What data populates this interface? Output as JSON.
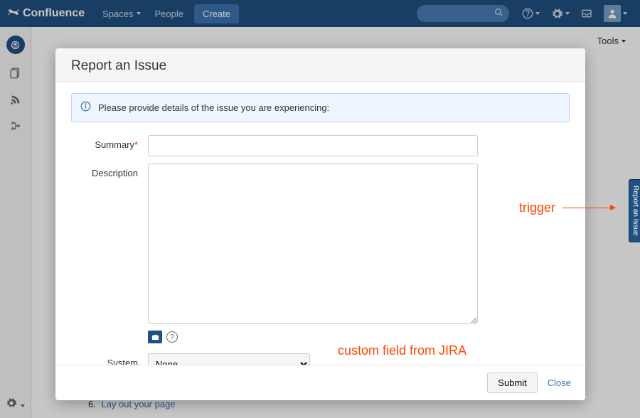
{
  "topnav": {
    "logo_text": "Confluence",
    "spaces": "Spaces",
    "people": "People",
    "create": "Create"
  },
  "page": {
    "tools": "Tools",
    "bottom_list_num": "6.",
    "bottom_link": "Lay out your page"
  },
  "side_tab": "Report an Issue",
  "modal": {
    "title": "Report an Issue",
    "banner": "Please provide details of the issue you are experiencing:",
    "summary_label": "Summary",
    "description_label": "Description",
    "system_label": "System",
    "system_value": "None",
    "submit": "Submit",
    "close": "Close"
  },
  "annotations": {
    "trigger": "trigger",
    "custom_field": "custom field from JIRA"
  }
}
